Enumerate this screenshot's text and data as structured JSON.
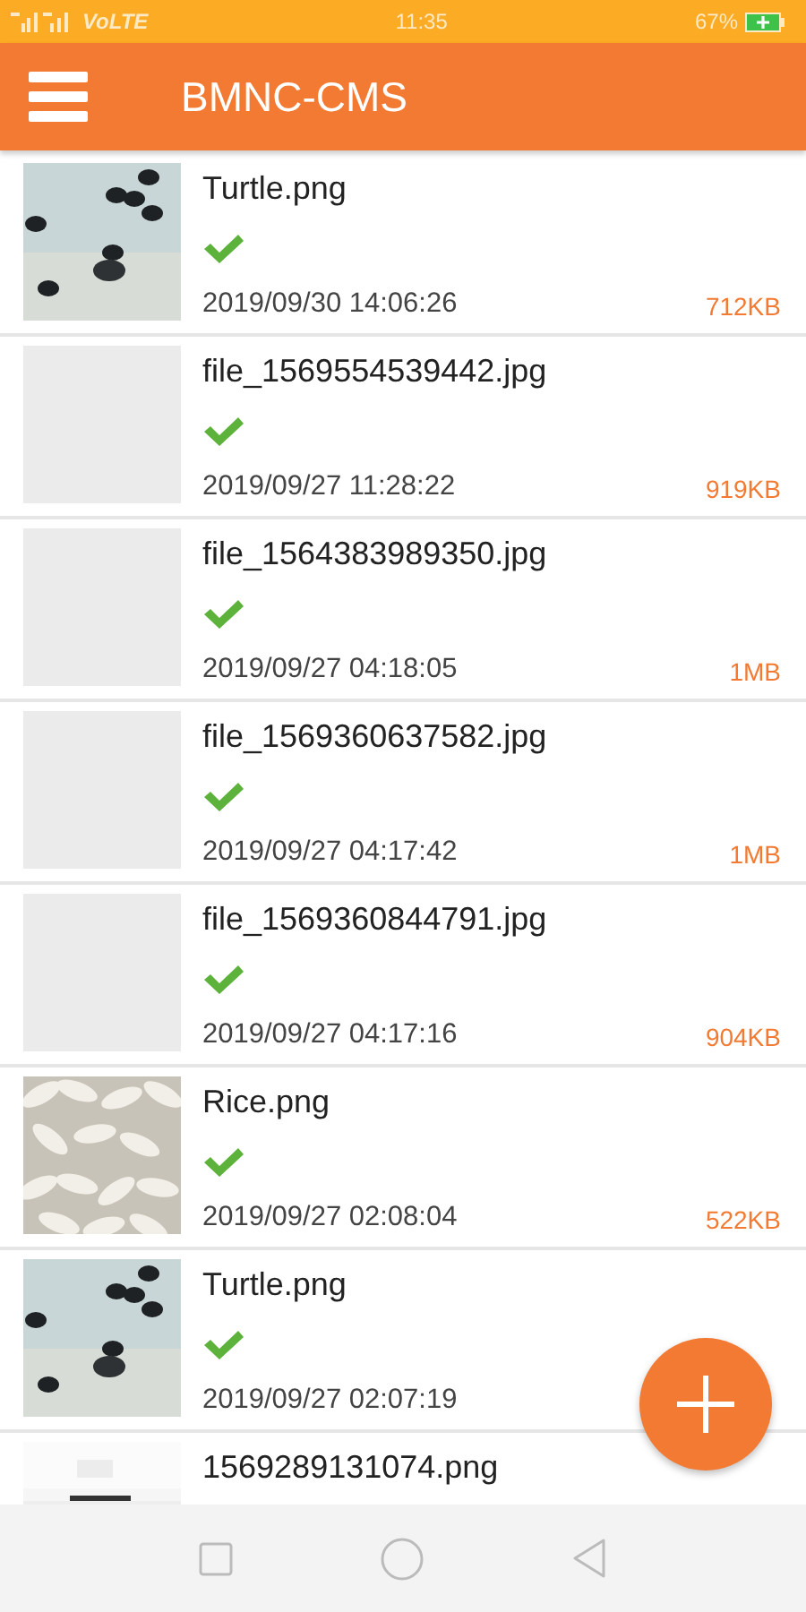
{
  "status_bar": {
    "network": "VoLTE",
    "time": "11:35",
    "battery": "67%"
  },
  "app_bar": {
    "title": "BMNC-CMS"
  },
  "files": [
    {
      "kind": "turtle",
      "name": "Turtle.png",
      "uploaded": true,
      "date": "2019/09/30 14:06:26",
      "size": "712KB"
    },
    {
      "kind": "placeholder",
      "name": "file_1569554539442.jpg",
      "uploaded": true,
      "date": "2019/09/27 11:28:22",
      "size": "919KB"
    },
    {
      "kind": "placeholder",
      "name": "file_1564383989350.jpg",
      "uploaded": true,
      "date": "2019/09/27 04:18:05",
      "size": "1MB"
    },
    {
      "kind": "placeholder",
      "name": "file_1569360637582.jpg",
      "uploaded": true,
      "date": "2019/09/27 04:17:42",
      "size": "1MB"
    },
    {
      "kind": "placeholder",
      "name": "file_1569360844791.jpg",
      "uploaded": true,
      "date": "2019/09/27 04:17:16",
      "size": "904KB"
    },
    {
      "kind": "rice",
      "name": "Rice.png",
      "uploaded": true,
      "date": "2019/09/27 02:08:04",
      "size": "522KB"
    },
    {
      "kind": "turtle",
      "name": "Turtle.png",
      "uploaded": true,
      "date": "2019/09/27 02:07:19"
    },
    {
      "kind": "document",
      "name": "1569289131074.png"
    }
  ]
}
